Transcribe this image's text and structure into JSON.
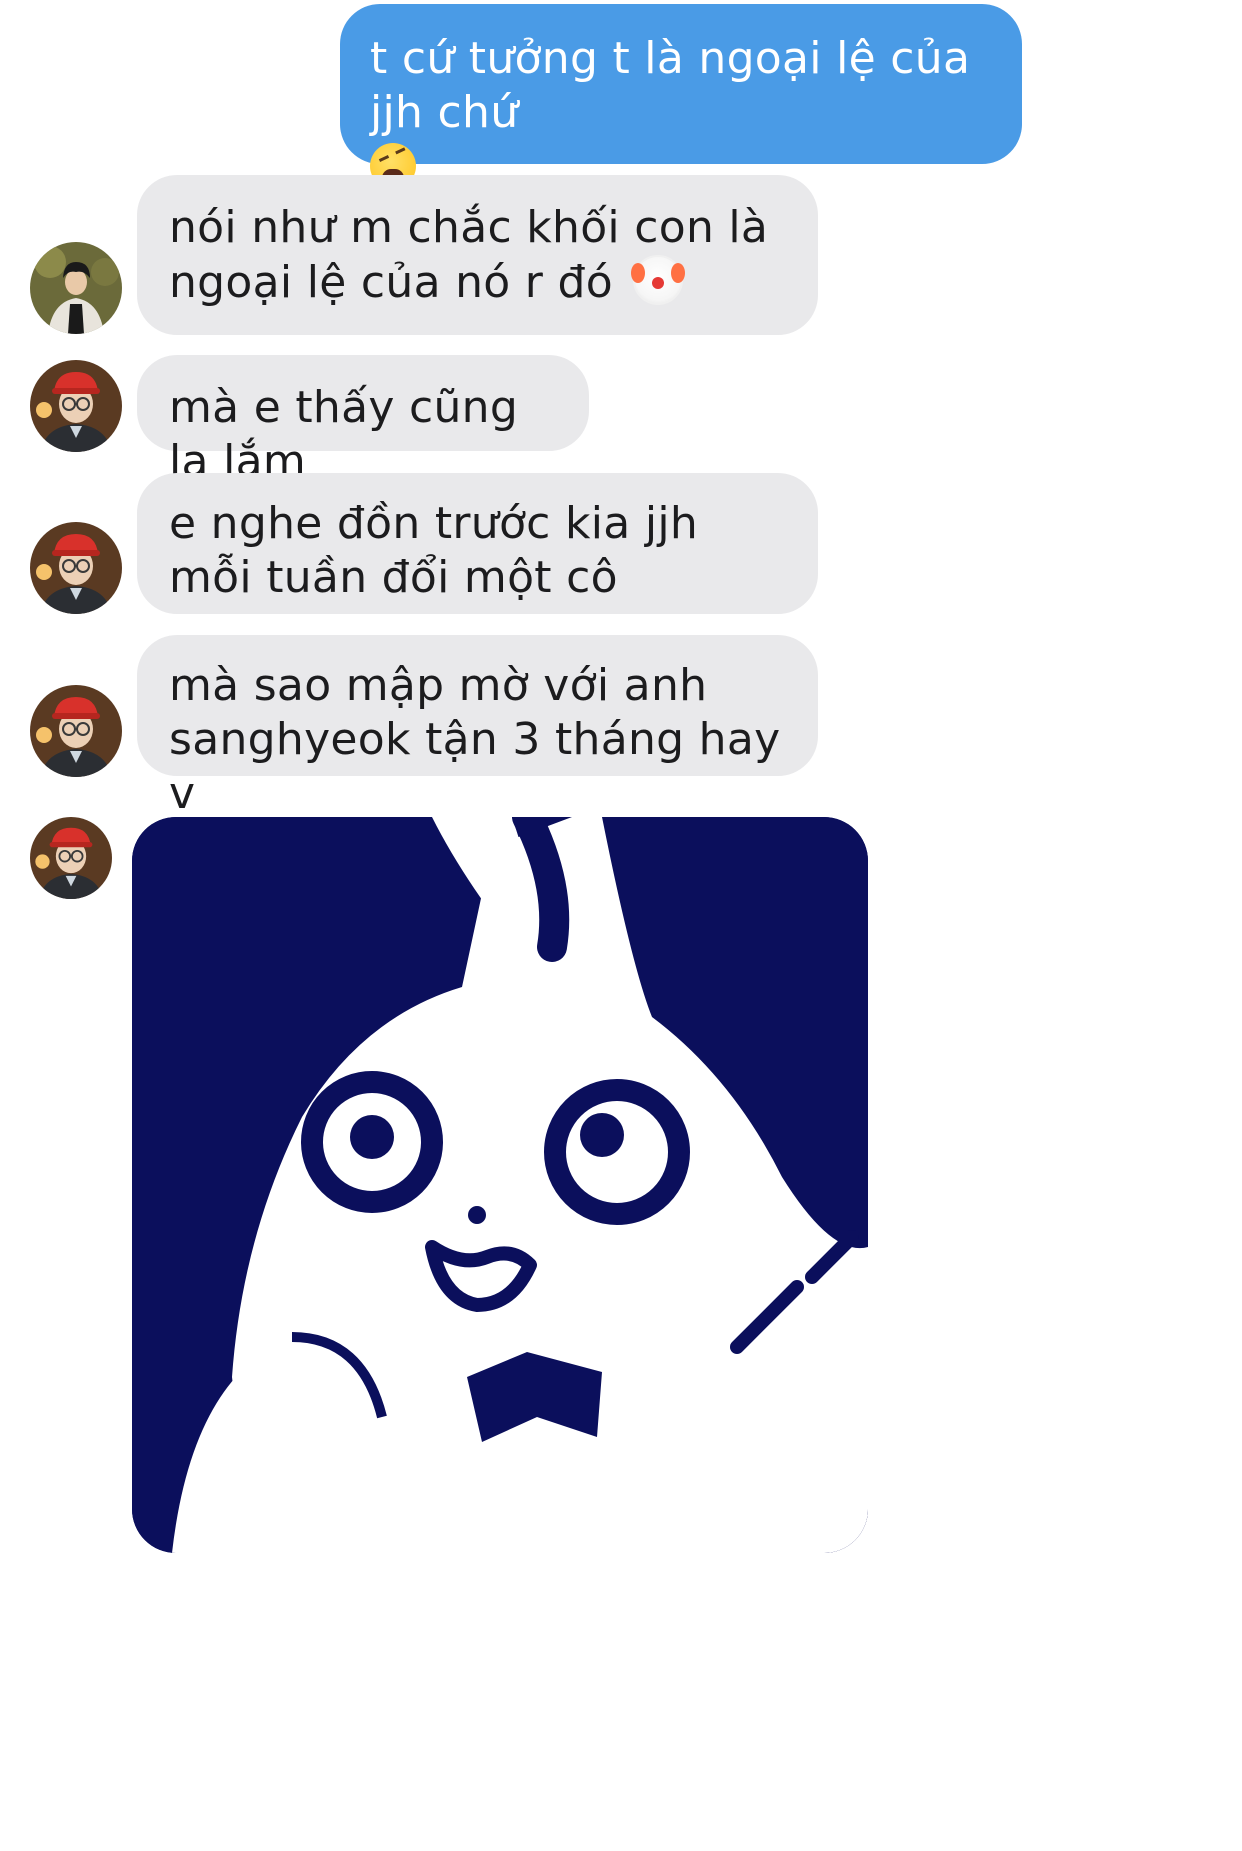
{
  "messages": [
    {
      "direction": "outgoing",
      "text": "t cứ tưởng t là ngoại lệ của jjh chứ",
      "emoji": "weary-face-emoji"
    },
    {
      "direction": "incoming",
      "sender_avatar": "avatar-dark-hair",
      "text": "nói như m chắc khối con là ngoại lệ của nó r đó",
      "emoji": "clown-face-emoji"
    },
    {
      "direction": "incoming",
      "sender_avatar": "avatar-red-cap",
      "text": "mà e thấy cũng lạ lắm"
    },
    {
      "direction": "incoming",
      "sender_avatar": "avatar-red-cap",
      "text": "e nghe đồn trước kia jjh mỗi tuần đổi một cô"
    },
    {
      "direction": "incoming",
      "sender_avatar": "avatar-red-cap",
      "text": "mà sao mập mờ với anh sanghyeok tận 3 tháng hay v"
    },
    {
      "direction": "incoming",
      "sender_avatar": "avatar-red-cap",
      "attachment": "sticker-white-rabbit-bow-tie"
    }
  ],
  "colors": {
    "outgoing_bubble": "#4a9be6",
    "incoming_bubble": "#e9e9eb",
    "outgoing_text": "#ffffff",
    "incoming_text": "#1c1c1e",
    "sticker_background": "#0b0f5c"
  }
}
